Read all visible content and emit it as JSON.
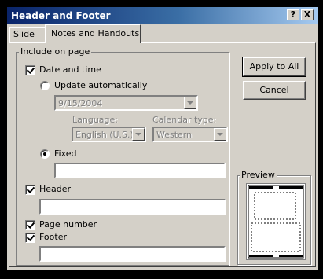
{
  "window": {
    "title": "Header and Footer",
    "help_glyph": "?",
    "close_glyph": "X"
  },
  "tabs": [
    {
      "label": "Slide"
    },
    {
      "label": "Notes and Handouts"
    }
  ],
  "include_on_page": {
    "legend": "Include on page",
    "date_and_time": {
      "label": "Date and time",
      "checked": true
    },
    "update_automatically": {
      "label": "Update automatically",
      "selected": false,
      "value": "9/15/2004"
    },
    "language": {
      "label": "Language:",
      "value": "English (U.S.)"
    },
    "calendar_type": {
      "label": "Calendar type:",
      "value": "Western"
    },
    "fixed": {
      "label": "Fixed",
      "selected": true,
      "value": ""
    },
    "header": {
      "label": "Header",
      "checked": true,
      "value": ""
    },
    "page_number": {
      "label": "Page number",
      "checked": true
    },
    "footer": {
      "label": "Footer",
      "checked": true,
      "value": ""
    }
  },
  "buttons": {
    "apply_to_all": "Apply to All",
    "cancel": "Cancel"
  },
  "preview": {
    "legend": "Preview"
  }
}
